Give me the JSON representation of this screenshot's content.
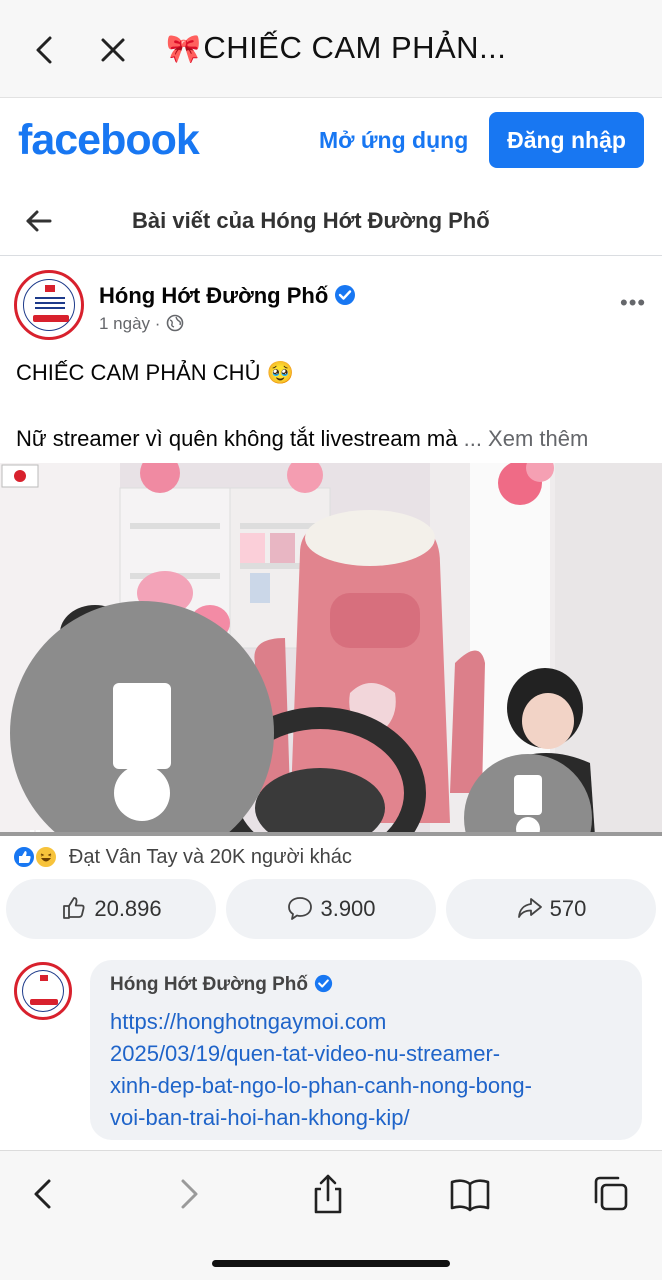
{
  "browser": {
    "tab_title": "CHIẾC CAM PHẢN...",
    "title_emoji": "🎀",
    "back_icon": "chevron-left-icon",
    "close_icon": "close-icon"
  },
  "fb_header": {
    "logo": "facebook",
    "open_app": "Mở ứng dụng",
    "login": "Đăng nhập",
    "brand_color": "#1877f2"
  },
  "nav": {
    "title": "Bài viết của Hóng Hớt Đường Phố"
  },
  "post": {
    "author": "Hóng Hớt Đường Phố",
    "time": "1 ngày",
    "separator": "·",
    "more": "•••",
    "caption_line1": "CHIẾC CAM PHẢN CHỦ 🥹",
    "caption_line2": "Nữ streamer vì quên không tắt livestream mà",
    "see_more": "... Xem thêm",
    "reactions_text": "Đạt Vân Tay và 20K người khác",
    "like_count": "20.896",
    "comment_count": "3.900",
    "share_count": "570"
  },
  "comment": {
    "author": "Hóng Hớt Đường Phố",
    "link_lines": [
      "https://honghotngaymoi.com",
      "2025/03/19/quen-tat-video-nu-streamer-",
      "xinh-dep-bat-ngo-lo-phan-canh-nong-bong-",
      "voi-ban-trai-hoi-han-khong-kip/"
    ]
  }
}
